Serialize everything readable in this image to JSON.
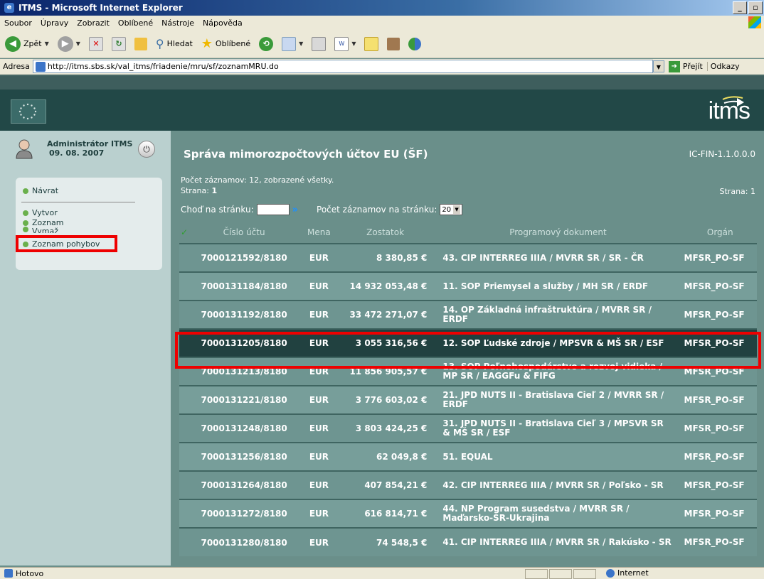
{
  "window": {
    "title": "ITMS - Microsoft Internet Explorer"
  },
  "menu": [
    "Soubor",
    "Úpravy",
    "Zobrazit",
    "Oblíbené",
    "Nástroje",
    "Nápověda"
  ],
  "toolbar": {
    "back": "Zpět",
    "search": "Hledat",
    "favorites": "Oblíbené"
  },
  "address": {
    "label": "Adresa",
    "url": "http://itms.sbs.sk/val_itms/friadenie/mru/sf/zoznamMRU.do",
    "go": "Přejít",
    "links": "Odkazy"
  },
  "header": {
    "logo": "itms"
  },
  "user": {
    "name": "Administrátor ITMS",
    "date": "09. 08. 2007"
  },
  "sidebar": {
    "items": [
      {
        "label": "Návrat"
      },
      {
        "label": "Vytvor"
      },
      {
        "label": "Zoznam"
      },
      {
        "label": "Vymaž"
      },
      {
        "label": "Zoznam pohybov"
      }
    ]
  },
  "page": {
    "title": "Správa mimorozpočtových účtov EU (ŠF)",
    "code": "IC-FIN-1.1.0.0.0",
    "records": "Počet záznamov: 12, zobrazené všetky.",
    "page_label": "Strana:",
    "page_num": "1",
    "page_right": "Strana: 1",
    "goto_label": "Choď na stránku:",
    "per_page_label": "Počet záznamov na stránku:",
    "per_page_value": "20"
  },
  "table": {
    "headers": [
      "Číslo účtu",
      "Mena",
      "Zostatok",
      "Programový dokument",
      "Orgán"
    ],
    "rows": [
      {
        "acc": "7000121592/8180",
        "cur": "EUR",
        "bal": "8 380,85 €",
        "doc": "43. CIP INTERREG IIIA / MVRR SR / SR - ČR",
        "org": "MFSR_PO-SF"
      },
      {
        "acc": "7000131184/8180",
        "cur": "EUR",
        "bal": "14 932 053,48 €",
        "doc": "11. SOP Priemysel a služby / MH SR / ERDF",
        "org": "MFSR_PO-SF"
      },
      {
        "acc": "7000131192/8180",
        "cur": "EUR",
        "bal": "33 472 271,07 €",
        "doc": "14. OP Základná infraštruktúra / MVRR SR / ERDF",
        "org": "MFSR_PO-SF"
      },
      {
        "acc": "7000131205/8180",
        "cur": "EUR",
        "bal": "3 055 316,56 €",
        "doc": "12. SOP Ľudské zdroje / MPSVR & MŠ SR / ESF",
        "org": "MFSR_PO-SF"
      },
      {
        "acc": "7000131213/8180",
        "cur": "EUR",
        "bal": "11 856 905,57 €",
        "doc": "13. SOP Poľnohospodárstvo a rozvoj vidieka / MP SR / EAGGFu & FIFG",
        "org": "MFSR_PO-SF"
      },
      {
        "acc": "7000131221/8180",
        "cur": "EUR",
        "bal": "3 776 603,02 €",
        "doc": "21. JPD NUTS II - Bratislava Cieľ 2 / MVRR SR / ERDF",
        "org": "MFSR_PO-SF"
      },
      {
        "acc": "7000131248/8180",
        "cur": "EUR",
        "bal": "3 803 424,25 €",
        "doc": "31. JPD NUTS II - Bratislava Cieľ 3 / MPSVR SR & MŠ SR / ESF",
        "org": "MFSR_PO-SF"
      },
      {
        "acc": "7000131256/8180",
        "cur": "EUR",
        "bal": "62 049,8 €",
        "doc": "51. EQUAL",
        "org": "MFSR_PO-SF"
      },
      {
        "acc": "7000131264/8180",
        "cur": "EUR",
        "bal": "407 854,21 €",
        "doc": "42. CIP INTERREG IIIA / MVRR SR / Poľsko - SR",
        "org": "MFSR_PO-SF"
      },
      {
        "acc": "7000131272/8180",
        "cur": "EUR",
        "bal": "616 814,71 €",
        "doc": "44. NP Program susedstva / MVRR SR / Maďarsko-SR-Ukrajina",
        "org": "MFSR_PO-SF"
      },
      {
        "acc": "7000131280/8180",
        "cur": "EUR",
        "bal": "74 548,5 €",
        "doc": "41. CIP INTERREG IIIA / MVRR SR / Rakúsko - SR",
        "org": "MFSR_PO-SF"
      }
    ]
  },
  "status": {
    "left": "Hotovo",
    "zone": "Internet"
  }
}
